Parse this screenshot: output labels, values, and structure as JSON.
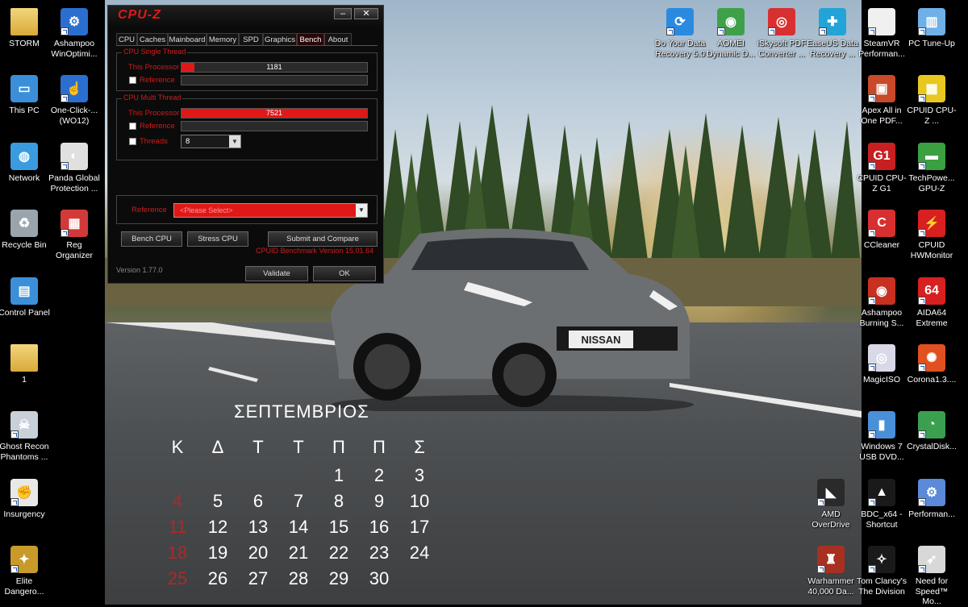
{
  "window": {
    "app_title": "CPU-Z",
    "tabs": [
      {
        "label": "CPU"
      },
      {
        "label": "Caches"
      },
      {
        "label": "Mainboard"
      },
      {
        "label": "Memory"
      },
      {
        "label": "SPD"
      },
      {
        "label": "Graphics"
      },
      {
        "label": "Bench"
      },
      {
        "label": "About"
      }
    ],
    "active_tab": "Bench",
    "single_thread": {
      "group_label": "CPU Single Thread",
      "this_processor_label": "This Processor",
      "this_processor_value": "1181",
      "this_processor_fill": 0.07,
      "reference_label": "Reference"
    },
    "multi_thread": {
      "group_label": "CPU Multi Thread",
      "this_processor_label": "This Processor",
      "this_processor_value": "7521",
      "this_processor_fill": 1.0,
      "reference_label": "Reference",
      "threads_label": "Threads",
      "threads_value": "8"
    },
    "reference_select": {
      "label": "Reference",
      "value": "<Please Select>"
    },
    "buttons": {
      "bench_cpu": "Bench CPU",
      "stress_cpu": "Stress CPU",
      "submit_compare": "Submit and Compare",
      "validate": "Validate",
      "ok": "OK"
    },
    "benchmark_version": "CPUID Benchmark Version 15.01.64",
    "version": "Version 1.77.0",
    "accent_color": "#e01818"
  },
  "desktop_icons_left": [
    {
      "label": "STORM",
      "icon": "folder-person-icon"
    },
    {
      "label": "Ashampoo WinOptimi...",
      "icon": "gear-icon"
    },
    {
      "label": "This PC",
      "icon": "computer-icon"
    },
    {
      "label": "One-Click-... (WO12)",
      "icon": "click-hand-icon"
    },
    {
      "label": "Network",
      "icon": "network-globe-icon"
    },
    {
      "label": "Panda Global Protection ...",
      "icon": "panda-icon"
    },
    {
      "label": "Recycle Bin",
      "icon": "recycle-bin-icon"
    },
    {
      "label": "Reg Organizer",
      "icon": "registry-icon"
    },
    {
      "label": "Control Panel",
      "icon": "control-panel-icon"
    },
    {
      "label": "1",
      "icon": "folder-icon"
    },
    {
      "label": "Ghost Recon Phantoms ...",
      "icon": "skull-icon"
    },
    {
      "label": "Insurgency",
      "icon": "fist-icon"
    },
    {
      "label": "Elite Dangero...",
      "icon": "elite-icon"
    }
  ],
  "desktop_icons_top": [
    {
      "label": "Do Your Data Recovery 5.0",
      "icon": "recovery-icon"
    },
    {
      "label": "AOMEI Dynamic D...",
      "icon": "disk-icon"
    },
    {
      "label": "iSkysoft PDF Converter ...",
      "icon": "pdf-icon"
    },
    {
      "label": "EaseUS Data Recovery ...",
      "icon": "easeus-icon"
    }
  ],
  "desktop_icons_right": [
    {
      "label": "SteamVR Performan...",
      "icon": "document-icon"
    },
    {
      "label": "PC Tune-Up",
      "icon": "tuneup-icon"
    },
    {
      "label": "Apex All in One PDF...",
      "icon": "pdf-box-icon"
    },
    {
      "label": "CPUID CPU-Z ...",
      "icon": "asr-cpu-icon"
    },
    {
      "label": "CPUID CPU-Z G1",
      "icon": "g1-cpu-icon"
    },
    {
      "label": "TechPowe... GPU-Z",
      "icon": "gpu-card-icon"
    },
    {
      "label": "CCleaner",
      "icon": "ccleaner-icon"
    },
    {
      "label": "CPUID HWMonitor",
      "icon": "hwmonitor-icon"
    },
    {
      "label": "Ashampoo Burning S...",
      "icon": "burning-icon"
    },
    {
      "label": "AIDA64 Extreme",
      "icon": "aida64-icon"
    },
    {
      "label": "MagicISO",
      "icon": "cd-icon"
    },
    {
      "label": "Corona1.3....",
      "icon": "corona-icon"
    },
    {
      "label": "Windows 7 USB DVD...",
      "icon": "usb-dvd-icon"
    },
    {
      "label": "CrystalDisk...",
      "icon": "crystaldisk-icon"
    },
    {
      "label": "AMD OverDrive",
      "icon": "amd-icon"
    },
    {
      "label": "BDC_x64 - Shortcut",
      "icon": "bdc-icon"
    },
    {
      "label": "Performan...",
      "icon": "performance-icon"
    },
    {
      "label": "Warhammer 40,000 Da...",
      "icon": "warhammer-icon"
    },
    {
      "label": "Tom Clancy's The Division",
      "icon": "division-icon"
    },
    {
      "label": "Need for Speed™ Mo...",
      "icon": "nfs-icon"
    }
  ],
  "calendar": {
    "month": "ΣΕΠΤΕΜΒΡΙΟΣ",
    "weekdays": [
      "Κ",
      "Δ",
      "Τ",
      "Τ",
      "Π",
      "Π",
      "Σ"
    ],
    "weeks": [
      [
        "",
        "",
        "",
        "",
        "1",
        "2",
        "3"
      ],
      [
        "4",
        "5",
        "6",
        "7",
        "8",
        "9",
        "10"
      ],
      [
        "11",
        "12",
        "13",
        "14",
        "15",
        "16",
        "17"
      ],
      [
        "18",
        "19",
        "20",
        "21",
        "22",
        "23",
        "24"
      ],
      [
        "25",
        "26",
        "27",
        "28",
        "29",
        "30",
        ""
      ]
    ],
    "sunday_color": "#b0282a"
  },
  "wallpaper": {
    "car_plate": "NISSAN"
  }
}
